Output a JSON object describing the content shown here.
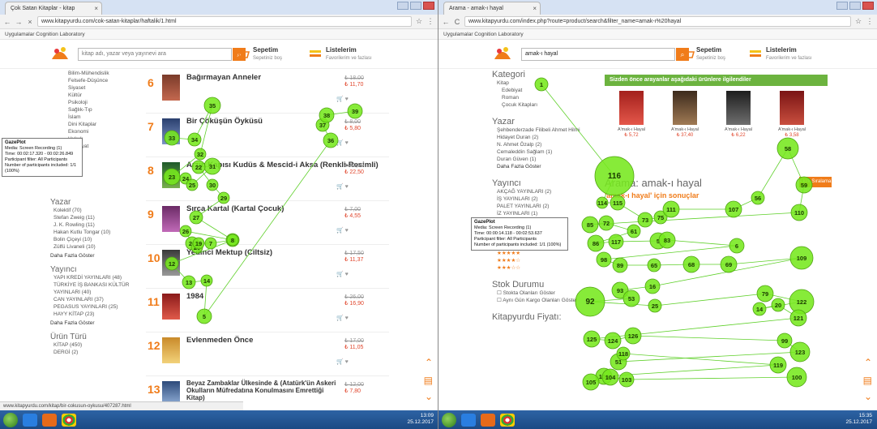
{
  "left": {
    "tab_title": "Çok Satan Kitaplar - kitap",
    "url": "www.kitapyurdu.com/cok-satan-kitaplar/haftalik/1.html",
    "bookmarks": "Uygulamalar   Cognition Laboratory",
    "search_placeholder": "kitap adı, yazar veya yayınevi ara",
    "cart_label": "Sepetim",
    "cart_sub": "Sepetiniz boş",
    "lists_label": "Listelerim",
    "lists_sub": "Favorilerim ve fazlası",
    "categories": [
      "Bilim-Mühendislik",
      "Felsefe-Düşünce",
      "Siyaset",
      "Kültür",
      "Psikoloji",
      "Sağlık-Tıp",
      "İslam",
      "Dini Kitaplar",
      "Ekonomi",
      "Hukuk",
      "Edebiyat",
      "Dil"
    ],
    "author_heading": "Yazar",
    "authors": [
      "Kolektif (70)",
      "Stefan Zweig (11)",
      "J. K. Rowling (11)",
      "Hakan Kutlu Tongar (10)",
      "Bolin Çiçeyi (10)",
      "Zülfü Livaneli (10)"
    ],
    "more_label": "Daha Fazla Göster",
    "publisher_heading": "Yayıncı",
    "publishers": [
      "YAPI KREDİ YAYINLARI (48)",
      "TÜRKİYE İŞ BANKASI KÜLTÜR YAYINLARI (40)",
      "CAN YAYINLARI (37)",
      "PEGASUS YAYINLARI (25)",
      "HAYY KİTAP (23)"
    ],
    "product_type_heading": "Ürün Türü",
    "product_types": [
      "KİTAP (450)",
      "DERGİ (2)"
    ],
    "products": [
      {
        "rank": "6",
        "title": "Bağırmayan Anneler",
        "price": "₺ 18,00",
        "sale": "₺ 11,70"
      },
      {
        "rank": "7",
        "title": "Bir Çöküşün Öyküsü",
        "price": "₺ 8,00",
        "sale": "₺ 5,80"
      },
      {
        "rank": "8",
        "title": "Arzın Kapısı Kudüs & Mescid-i Aksa (Renkli-Resimli)",
        "price": "₺ 30,00",
        "sale": "₺ 22,50"
      },
      {
        "rank": "9",
        "title": "Sırça Kartal (Kartal Çocuk)",
        "price": "₺ 7,00",
        "sale": "₺ 4,55"
      },
      {
        "rank": "10",
        "title": "Yedinci Mektup (Ciltsiz)",
        "price": "₺ 17,50",
        "sale": "₺ 11,37"
      },
      {
        "rank": "11",
        "title": "1984",
        "price": "₺ 26,00",
        "sale": "₺ 16,90"
      },
      {
        "rank": "12",
        "title": "Evlenmeden Önce",
        "price": "₺ 17,00",
        "sale": "₺ 11,05"
      },
      {
        "rank": "13",
        "title": "Beyaz Zambaklar Ülkesinde & (Atatürk'ün Askeri Okulların Müfredatına Konulmasını Emrettiği Kitap)",
        "price": "₺ 12,00",
        "sale": "₺ 7,80"
      }
    ],
    "status_url": "www.kitapyurdu.com/kitap/bir-cokusun-oykusu/407287.html",
    "legend": [
      "GazePlot",
      "Media: Screen Recording (1)",
      "Time: 00:02:17.320 - 00:02:26.849",
      "Participant filter: All Participants",
      "Number of participants included: 1/1 (100%)"
    ],
    "clock_time": "13:09",
    "clock_date": "25.12.2017"
  },
  "right": {
    "tab_title": "Arama - amak-ı hayal",
    "url": "www.kitapyurdu.com/index.php?route=product/search&filter_name=amak-ı%20hayal",
    "bookmarks": "Uygulamalar   Cognition Laboratory",
    "search_value": "amak-ı hayal",
    "cart_label": "Sepetim",
    "cart_sub": "Sepetiniz boş",
    "lists_label": "Listelerim",
    "lists_sub": "Favorilerim ve fazlası",
    "category_heading": "Kategori",
    "categories": [
      "Kitap",
      "Edebiyat",
      "Roman",
      "Çocuk Kitapları"
    ],
    "author_heading": "Yazar",
    "authors": [
      "Şehbenderzade Filibeli Ahmet Hilmi",
      "Hidayet Duran (2)",
      "N. Ahmet Özalp (2)",
      "Cemaleddin Sağlam (1)",
      "Duran Güven (1)"
    ],
    "more_label": "Daha Fazla Göster",
    "publisher_heading": "Yayıncı",
    "publishers": [
      "AKÇAĞ YAYINLARI (2)",
      "İŞ YAYINLARI (2)",
      "PALET YAYINLARI (2)",
      "İZ YAYINLARI (1)",
      "VARLIK YAYINLARI (1)"
    ],
    "rating_heading": "Oylama",
    "stock_heading": "Stok Durumu",
    "stock_options": [
      "Stokta Olanları Göster",
      "Aynı Gün Kargo Olanları Göster"
    ],
    "price_heading": "Kitapyurdu Fiyatı:",
    "banner": "Sizden önce arayanlar aşağıdaki ürünlere ilgilendiler",
    "recs": [
      {
        "name": "A'mak-ı Hayal",
        "price": "₺ 5,72"
      },
      {
        "name": "A'mak-ı Hayal",
        "price": "₺ 37,40"
      },
      {
        "name": "A'mak-ı Hayal",
        "price": "₺ 6,22"
      },
      {
        "name": "A'mak-ı Hayal",
        "price": "₺ 3,58"
      }
    ],
    "results_title": "Arama: amak-ı hayal",
    "results_sub": "'amak-ı hayal' için sonuçlar",
    "order_label": "Akıllı Sıralama",
    "legend": [
      "GazePlot",
      "Media: Screen Recording (1)",
      "Time: 00:00:14.118 - 00:02:53.637",
      "Participant filter: All Participants",
      "Number of participants included: 1/1 (100%)"
    ],
    "clock_time": "15:35",
    "clock_date": "25.12.2017"
  },
  "left_fixations": [
    {
      "n": "33"
    },
    {
      "n": "34"
    },
    {
      "n": "35"
    },
    {
      "n": "32"
    },
    {
      "n": "23"
    },
    {
      "n": "24"
    },
    {
      "n": "25"
    },
    {
      "n": "31"
    },
    {
      "n": "22"
    },
    {
      "n": "30"
    },
    {
      "n": "29"
    },
    {
      "n": "27"
    },
    {
      "n": "28"
    },
    {
      "n": "26"
    },
    {
      "n": "21"
    },
    {
      "n": "20"
    },
    {
      "n": "19"
    },
    {
      "n": "7"
    },
    {
      "n": "8"
    },
    {
      "n": "12"
    },
    {
      "n": "13"
    },
    {
      "n": "14"
    },
    {
      "n": "5"
    },
    {
      "n": "36"
    },
    {
      "n": "37"
    },
    {
      "n": "38"
    },
    {
      "n": "39"
    }
  ],
  "right_fixations": [
    {
      "n": "1"
    },
    {
      "n": "116"
    },
    {
      "n": "114"
    },
    {
      "n": "115"
    },
    {
      "n": "73"
    },
    {
      "n": "75"
    },
    {
      "n": "111"
    },
    {
      "n": "107"
    },
    {
      "n": "56"
    },
    {
      "n": "58"
    },
    {
      "n": "59"
    },
    {
      "n": "110"
    },
    {
      "n": "85"
    },
    {
      "n": "72"
    },
    {
      "n": "61"
    },
    {
      "n": "86"
    },
    {
      "n": "117"
    },
    {
      "n": "5"
    },
    {
      "n": "83"
    },
    {
      "n": "6"
    },
    {
      "n": "98"
    },
    {
      "n": "89"
    },
    {
      "n": "65"
    },
    {
      "n": "68"
    },
    {
      "n": "69"
    },
    {
      "n": "109"
    },
    {
      "n": "16"
    },
    {
      "n": "93"
    },
    {
      "n": "53"
    },
    {
      "n": "92"
    },
    {
      "n": "25"
    },
    {
      "n": "79"
    },
    {
      "n": "122"
    },
    {
      "n": "14"
    },
    {
      "n": "20"
    },
    {
      "n": "121"
    },
    {
      "n": "125"
    },
    {
      "n": "124"
    },
    {
      "n": "126"
    },
    {
      "n": "99"
    },
    {
      "n": "123"
    },
    {
      "n": "51"
    },
    {
      "n": "118"
    },
    {
      "n": "119"
    },
    {
      "n": "106"
    },
    {
      "n": "105"
    },
    {
      "n": "104"
    },
    {
      "n": "103"
    },
    {
      "n": "100"
    }
  ]
}
